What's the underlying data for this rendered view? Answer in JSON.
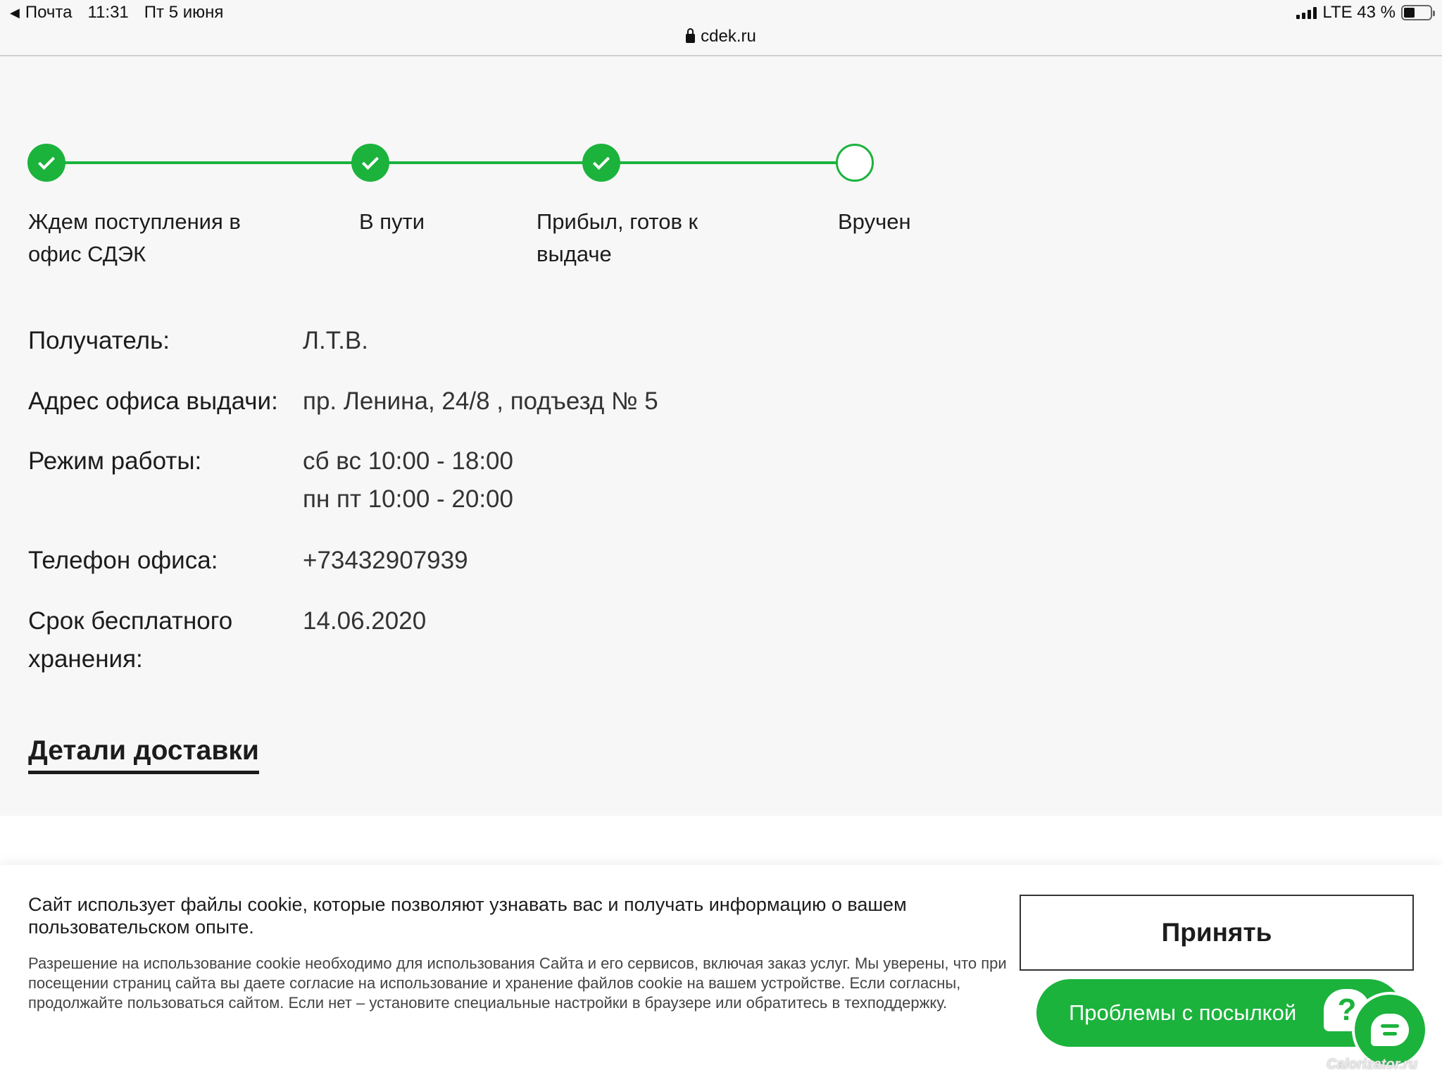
{
  "status_bar": {
    "back_app": "Почта",
    "time": "11:31",
    "date": "Пт 5 июня",
    "network": "LTE 43 %"
  },
  "url": "cdek.ru",
  "tracker": {
    "steps": [
      {
        "label": "Ждем поступления в офис СДЭК",
        "state": "done"
      },
      {
        "label": "В пути",
        "state": "done"
      },
      {
        "label": "Прибыл, готов к выдаче",
        "state": "done"
      },
      {
        "label": "Вручен",
        "state": "pending"
      }
    ],
    "accent": "#1bb33c"
  },
  "info": {
    "recipient_label": "Получатель:",
    "recipient_value": "Л.Т.В.",
    "address_label": "Адрес офиса выдачи:",
    "address_value": "пр. Ленина, 24/8 , подъезд № 5",
    "hours_label": "Режим работы:",
    "hours_line1": "сб вс 10:00 - 18:00",
    "hours_line2": "пн пт 10:00 - 20:00",
    "phone_label": "Телефон офиса:",
    "phone_value": "+73432907939",
    "storage_label_line1": "Срок бесплатного",
    "storage_label_line2": "хранения:",
    "storage_value": "14.06.2020"
  },
  "details_link": "Детали доставки",
  "cookie": {
    "title": "Сайт использует файлы cookie, которые позволяют узнавать вас и получать информацию о вашем пользовательском опыте.",
    "text": "Разрешение на использование cookie необходимо для использования Сайта и его сервисов, включая заказ услуг. Мы уверены, что при посещении страниц сайта вы даете согласие на использование и хранение файлов cookie на вашем устройстве. Если согласны, продолжайте пользоваться сайтом. Если нет – установите специальные настройки в браузере или обратитесь в техподдержку.",
    "accept_label": "Принять",
    "problems_label": "Проблемы с посылкой",
    "help_glyph": "?"
  },
  "watermark": "Calorizator.ru"
}
